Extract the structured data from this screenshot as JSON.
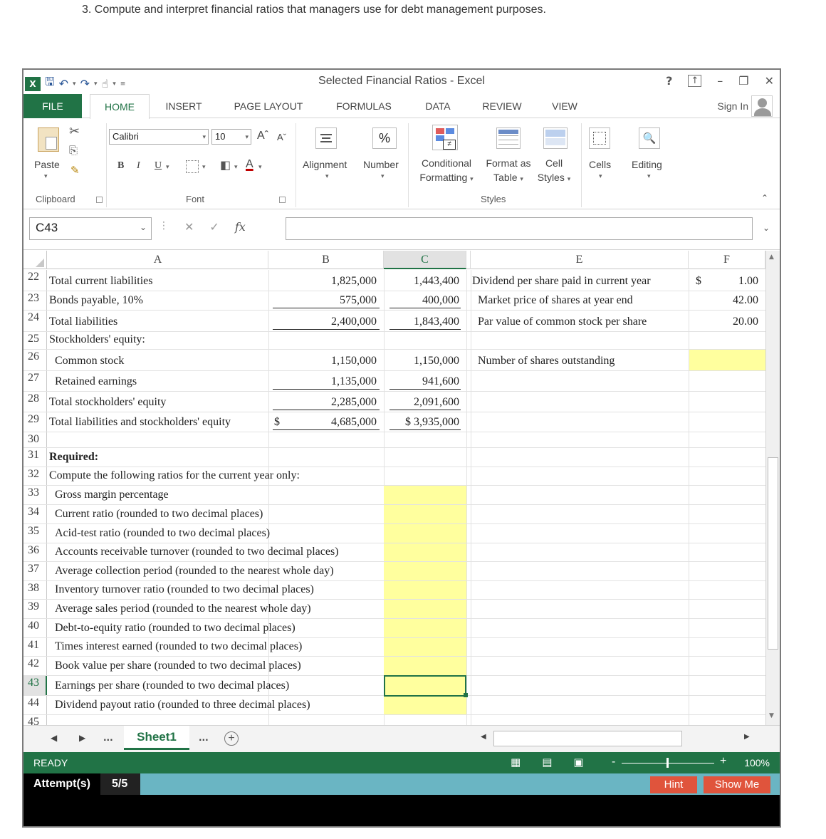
{
  "heading": "3. Compute and interpret financial ratios that managers use for debt management purposes.",
  "window": {
    "title": "Selected Financial Ratios - Excel",
    "help": "?",
    "sign_in": "Sign In"
  },
  "tabs": [
    "FILE",
    "HOME",
    "INSERT",
    "PAGE LAYOUT",
    "FORMULAS",
    "DATA",
    "REVIEW",
    "VIEW"
  ],
  "ribbon": {
    "paste": "Paste",
    "clipboard": "Clipboard",
    "font_name": "Calibri",
    "font_size": "10",
    "font_group": "Font",
    "bold": "B",
    "italic": "I",
    "underline": "U",
    "alignment": "Alignment",
    "number": "Number",
    "percent": "%",
    "conditional_1": "Conditional",
    "conditional_2": "Formatting",
    "format_as_1": "Format as",
    "format_as_2": "Table",
    "cell_styles_1": "Cell",
    "cell_styles_2": "Styles",
    "styles_group": "Styles",
    "cells": "Cells",
    "editing": "Editing"
  },
  "formula_bar": {
    "name_box": "C43",
    "formula": ""
  },
  "columns": [
    "A",
    "B",
    "C",
    "",
    "E",
    "F"
  ],
  "rows": [
    {
      "n": "22",
      "a": "Total current liabilities",
      "b": "1,825,000",
      "c": "1,443,400",
      "e": "Dividend per share paid in current year",
      "f_sym": "$",
      "f": "1.00"
    },
    {
      "n": "23",
      "a": "Bonds payable, 10%",
      "b": "575,000",
      "c": "400,000",
      "e": "Market price of shares at year end",
      "f": "42.00"
    },
    {
      "n": "24",
      "a": "Total liabilities",
      "b": "2,400,000",
      "c": "1,843,400",
      "e": "Par value of common stock per share",
      "f": "20.00"
    },
    {
      "n": "25",
      "a": "Stockholders' equity:"
    },
    {
      "n": "26",
      "a": "Common stock",
      "b": "1,150,000",
      "c": "1,150,000",
      "e": "Number of shares outstanding"
    },
    {
      "n": "27",
      "a": "Retained earnings",
      "b": "1,135,000",
      "c": "941,600"
    },
    {
      "n": "28",
      "a": "Total stockholders' equity",
      "b": "2,285,000",
      "c": "2,091,600"
    },
    {
      "n": "29",
      "a": "Total liabilities and stockholders' equity",
      "b_sym": "$",
      "b": "4,685,000",
      "c": "$  3,935,000"
    },
    {
      "n": "30"
    },
    {
      "n": "31",
      "a": "Required:"
    },
    {
      "n": "32",
      "a": "Compute the following ratios for the current year only:"
    },
    {
      "n": "33",
      "a": "Gross margin percentage"
    },
    {
      "n": "34",
      "a": "Current ratio (rounded to two decimal places)"
    },
    {
      "n": "35",
      "a": "Acid-test ratio (rounded to two decimal places)"
    },
    {
      "n": "36",
      "a": "Accounts receivable turnover (rounded to two decimal places)"
    },
    {
      "n": "37",
      "a": "Average collection period (rounded to the nearest whole day)"
    },
    {
      "n": "38",
      "a": "Inventory turnover ratio (rounded to two decimal places)"
    },
    {
      "n": "39",
      "a": "Average sales period (rounded to the nearest whole day)"
    },
    {
      "n": "40",
      "a": "Debt-to-equity ratio (rounded to two decimal places)"
    },
    {
      "n": "41",
      "a": "Times interest earned (rounded to two decimal places)"
    },
    {
      "n": "42",
      "a": "Book value per share (rounded to two decimal places)"
    },
    {
      "n": "43",
      "a": "Earnings per share (rounded to two decimal places)"
    },
    {
      "n": "44",
      "a": "Dividend payout ratio (rounded to three decimal places)"
    },
    {
      "n": "45"
    }
  ],
  "sheet": {
    "name": "Sheet1",
    "ellipsis": "..."
  },
  "status": {
    "ready": "READY",
    "zoom": "100%"
  },
  "attempts": {
    "label": "Attempt(s)",
    "value": "5/5",
    "hint": "Hint",
    "show_me": "Show Me"
  },
  "colors": {
    "excel_green": "#217346",
    "input_yellow": "#ffff9e",
    "attempt_bar": "#6ab5c3",
    "button_red": "#e0543c"
  }
}
